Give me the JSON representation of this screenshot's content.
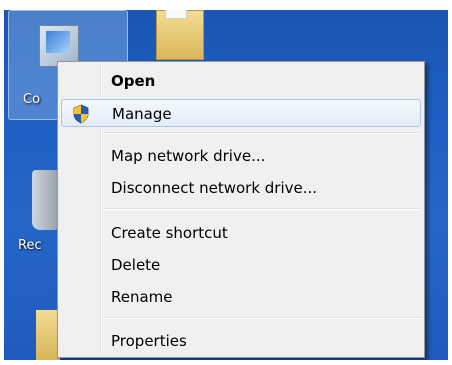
{
  "desktop": {
    "icons": [
      {
        "label": "Co"
      },
      {
        "label": "Rec"
      }
    ]
  },
  "context_menu": {
    "items": [
      {
        "label": "Open",
        "bold": true
      },
      {
        "label": "Manage",
        "icon": "uac-shield-icon",
        "highlighted": true
      },
      {
        "label": "Map network drive..."
      },
      {
        "label": "Disconnect network drive..."
      },
      {
        "label": "Create shortcut"
      },
      {
        "label": "Delete"
      },
      {
        "label": "Rename"
      },
      {
        "label": "Properties"
      }
    ]
  },
  "colors": {
    "desktop_blue": "#1d5fc2",
    "menu_background": "#f0f0f0",
    "highlight_border": "#a8c6ea"
  }
}
